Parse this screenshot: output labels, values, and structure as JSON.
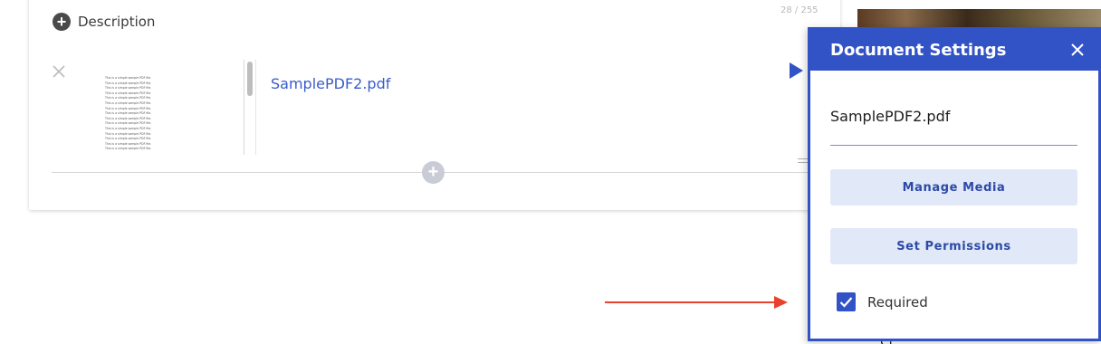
{
  "card": {
    "description_label": "Description",
    "char_counter": "28 / 255",
    "file_name": "SamplePDF2.pdf",
    "thumbnail_line_text": "This is a simple sample PDF file."
  },
  "panel": {
    "title": "Document Settings",
    "document_name": "SamplePDF2.pdf",
    "manage_media_label": "Manage Media",
    "set_permissions_label": "Set Permissions",
    "required_label": "Required",
    "required_checked": true
  },
  "background": {
    "partial_text": "Cl"
  },
  "colors": {
    "accent": "#3253c6",
    "button_bg": "#e1e8f8",
    "annotation_arrow": "#e8412c"
  },
  "icons": [
    "plus-circle-icon",
    "close-icon",
    "play-icon",
    "add-circle-icon",
    "drag-handle-icon",
    "checkmark-icon"
  ]
}
